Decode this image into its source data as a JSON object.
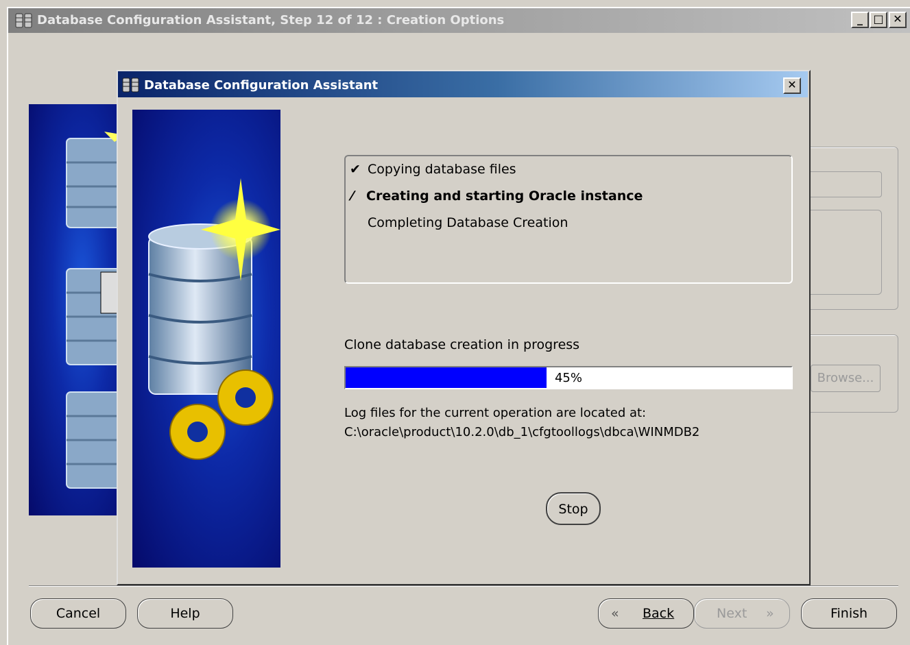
{
  "main_window": {
    "title": "Database Configuration Assistant, Step 12 of 12 : Creation Options",
    "controls": {
      "minimize": "_",
      "maximize": "□",
      "close": "✕"
    }
  },
  "background": {
    "browse_button": "Browse..."
  },
  "dialog": {
    "title": "Database Configuration Assistant",
    "close": "✕",
    "steps": [
      {
        "mark": "✔",
        "label": "Copying database files",
        "state": "done"
      },
      {
        "mark": "⁄",
        "label": "Creating and starting Oracle instance",
        "state": "active"
      },
      {
        "mark": "",
        "label": "Completing Database Creation",
        "state": "pending"
      }
    ],
    "progress_heading": "Clone database creation in progress",
    "progress": {
      "value": 45,
      "label": "45%"
    },
    "log_intro": "Log files for the current operation are located at:",
    "log_path": "C:\\oracle\\product\\10.2.0\\db_1\\cfgtoollogs\\dbca\\WINMDB2",
    "stop_button": "Stop"
  },
  "footer": {
    "cancel": "Cancel",
    "help": "Help",
    "back": "Back",
    "next": "Next",
    "finish": "Finish",
    "back_arrow": "«",
    "next_arrow": "»"
  },
  "colors": {
    "progress_fill": "#0000ff",
    "title_active": "#0a246a",
    "title_inactive": "#808080",
    "panel_blue": "#0d2aa8"
  },
  "icons": {
    "app": "database-icon",
    "panel_art": "database-cylinders-gears-art"
  }
}
